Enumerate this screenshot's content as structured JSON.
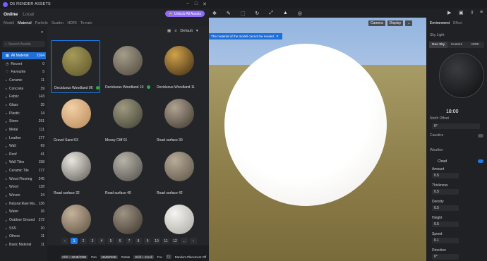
{
  "window": {
    "title": "D5 RENDER ASSETS",
    "minimize": "−",
    "maximize": "□",
    "close": "✕"
  },
  "header": {
    "online": "Online",
    "local": "Local",
    "unlock": "Unlock All Assets"
  },
  "tabs": [
    "Model",
    "Material",
    "Particle",
    "Scatter",
    "HDRI",
    "Terrain"
  ],
  "active_tab": "Material",
  "search": {
    "placeholder": "Search Assets"
  },
  "categories": [
    {
      "label": "All Material",
      "count": "2164",
      "icon": "grid-icon",
      "active": true
    },
    {
      "label": "Recent",
      "count": "0",
      "icon": "clock-icon"
    },
    {
      "label": "Favourite",
      "count": "5",
      "icon": "heart-icon"
    },
    {
      "label": "Ceramic",
      "count": "11"
    },
    {
      "label": "Concrete",
      "count": "39"
    },
    {
      "label": "Fabric",
      "count": "143"
    },
    {
      "label": "Glass",
      "count": "35"
    },
    {
      "label": "Plastic",
      "count": "14"
    },
    {
      "label": "Stone",
      "count": "291"
    },
    {
      "label": "Metal",
      "count": "111"
    },
    {
      "label": "Leather",
      "count": "177"
    },
    {
      "label": "Wall",
      "count": "69"
    },
    {
      "label": "Roof",
      "count": "41"
    },
    {
      "label": "Wall Tiles",
      "count": "158"
    },
    {
      "label": "Ceramic Tile",
      "count": "177"
    },
    {
      "label": "Wood Flooring",
      "count": "245"
    },
    {
      "label": "Wood",
      "count": "128"
    },
    {
      "label": "Woven",
      "count": "24"
    },
    {
      "label": "Natural Raw Ma...",
      "count": "136"
    },
    {
      "label": "Water",
      "count": "16"
    },
    {
      "label": "Outdoor Ground",
      "count": "272"
    },
    {
      "label": "SSS",
      "count": "10"
    },
    {
      "label": "Others",
      "count": "11"
    },
    {
      "label": "Basic Material",
      "count": "11"
    }
  ],
  "sort": {
    "label": "Default"
  },
  "materials": [
    {
      "name": "Deciduous Woodland 06",
      "selected": true,
      "downloaded": true,
      "c1": "#a59a5a",
      "c2": "#5b5426"
    },
    {
      "name": "Deciduous Woodland 10",
      "downloaded": true,
      "c1": "#a49d8a",
      "c2": "#4d463b"
    },
    {
      "name": "Deciduous Woodland 11",
      "c1": "#d1a24a",
      "c2": "#3a2a14"
    },
    {
      "name": "Gravel Sand 03",
      "c1": "#f2d0a6",
      "c2": "#b78758"
    },
    {
      "name": "Mossy Cliff 01",
      "c1": "#9e9a80",
      "c2": "#3f3d30"
    },
    {
      "name": "Road surface 30",
      "c1": "#b0a392",
      "c2": "#3b342c"
    },
    {
      "name": "Road surface 32",
      "c1": "#e8e6df",
      "c2": "#5c5852"
    },
    {
      "name": "Road surface 40",
      "c1": "#b6b3aa",
      "c2": "#4f4c47"
    },
    {
      "name": "Road surface 42",
      "c1": "#b7ab98",
      "c2": "#5a5044"
    },
    {
      "name": "",
      "c1": "#c4b39c",
      "c2": "#5b4d3d"
    },
    {
      "name": "",
      "c1": "#9e9384",
      "c2": "#3c342b"
    },
    {
      "name": "",
      "c1": "#f5f4f0",
      "c2": "#a8a6a0"
    }
  ],
  "pages": [
    "1",
    "2",
    "3",
    "4",
    "5",
    "6",
    "7",
    "8",
    "9",
    "10",
    "11",
    "12",
    "..."
  ],
  "viewport": {
    "toast": "The material of the model cannot be reused.",
    "camera": "Camera",
    "display": "Display",
    "hints": [
      {
        "key": "Shift + MMB/RMB",
        "action": "Pan"
      },
      {
        "key": "MMB/RMB",
        "action": "Rotate"
      },
      {
        "key": "Shift + Scroll",
        "action": "Fov"
      },
      {
        "key": "",
        "action": "Random Placement Off"
      }
    ]
  },
  "right": {
    "tabs": [
      "Environment",
      "Effect"
    ],
    "sky_light": "Sky Light",
    "sky_tabs": [
      "Geo Sky",
      "Custom",
      "HDRI"
    ],
    "time": "18:00",
    "north_offset": "North Offset",
    "north_value": "0°",
    "caustics": "Caustics",
    "weather": "Weather",
    "cloud": "Cloud",
    "params": [
      {
        "label": "Amount",
        "value": "0.5"
      },
      {
        "label": "Thickness",
        "value": "0.5"
      },
      {
        "label": "Density",
        "value": "0.5"
      },
      {
        "label": "Height",
        "value": "0.5"
      },
      {
        "label": "Speed",
        "value": "0.1"
      },
      {
        "label": "Direction",
        "value": "0°"
      }
    ]
  }
}
